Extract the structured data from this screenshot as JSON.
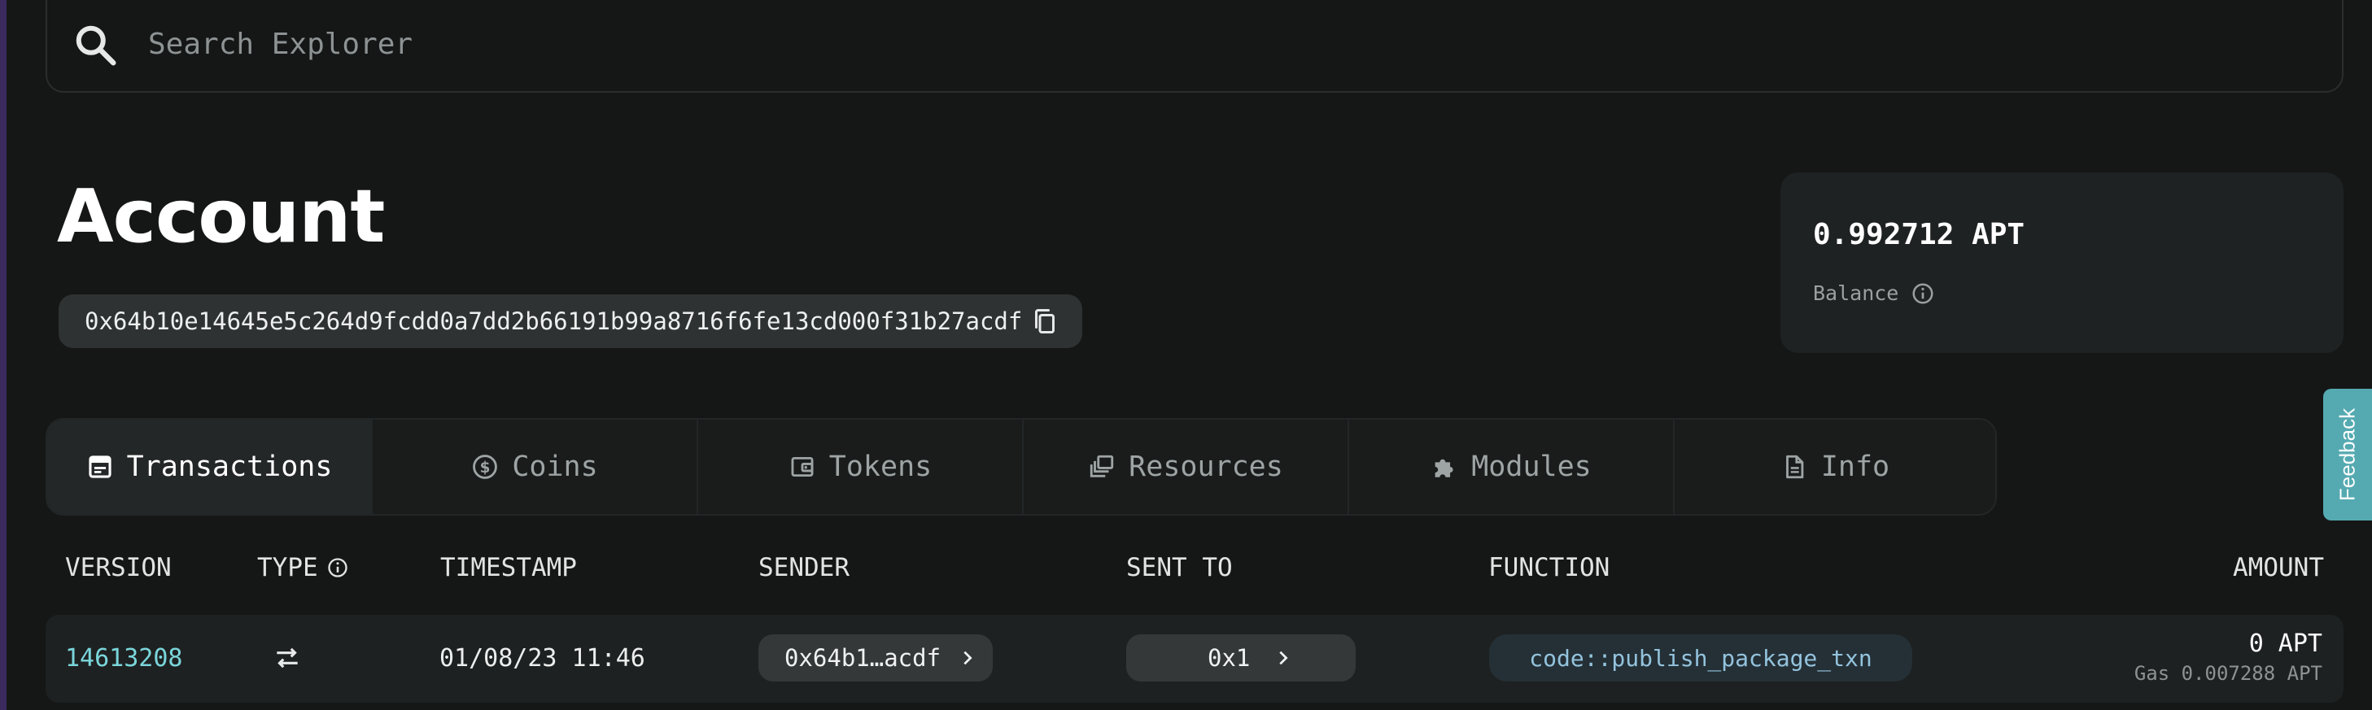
{
  "search": {
    "placeholder": "Search Explorer",
    "icon": "search-icon"
  },
  "account": {
    "title": "Account",
    "address": "0x64b10e14645e5c264d9fcdd0a7dd2b66191b99a8716f6fe13cd000f31b27acdf"
  },
  "balance": {
    "amount": "0.992712 APT",
    "label": "Balance"
  },
  "tabs": [
    {
      "label": "Transactions",
      "icon": "transactions-icon",
      "active": true
    },
    {
      "label": "Coins",
      "icon": "coin-icon",
      "active": false
    },
    {
      "label": "Tokens",
      "icon": "wallet-icon",
      "active": false
    },
    {
      "label": "Resources",
      "icon": "resources-icon",
      "active": false
    },
    {
      "label": "Modules",
      "icon": "puzzle-icon",
      "active": false
    },
    {
      "label": "Info",
      "icon": "document-icon",
      "active": false
    }
  ],
  "table": {
    "headers": {
      "version": "VERSION",
      "type": "TYPE",
      "timestamp": "TIMESTAMP",
      "sender": "SENDER",
      "sent_to": "SENT TO",
      "function": "FUNCTION",
      "amount": "AMOUNT"
    },
    "rows": [
      {
        "version": "14613208",
        "type_icon": "transfer-arrows-icon",
        "timestamp": "01/08/23 11:46",
        "sender": "0x64b1…acdf",
        "sent_to": "0x1",
        "function": "code::publish_package_txn",
        "amount": "0 APT",
        "gas": "Gas 0.007288 APT"
      }
    ]
  },
  "feedback": {
    "label": "Feedback"
  },
  "colors": {
    "accent": "#7ad6dc",
    "feedback": "#55aab1",
    "background": "#151717"
  }
}
